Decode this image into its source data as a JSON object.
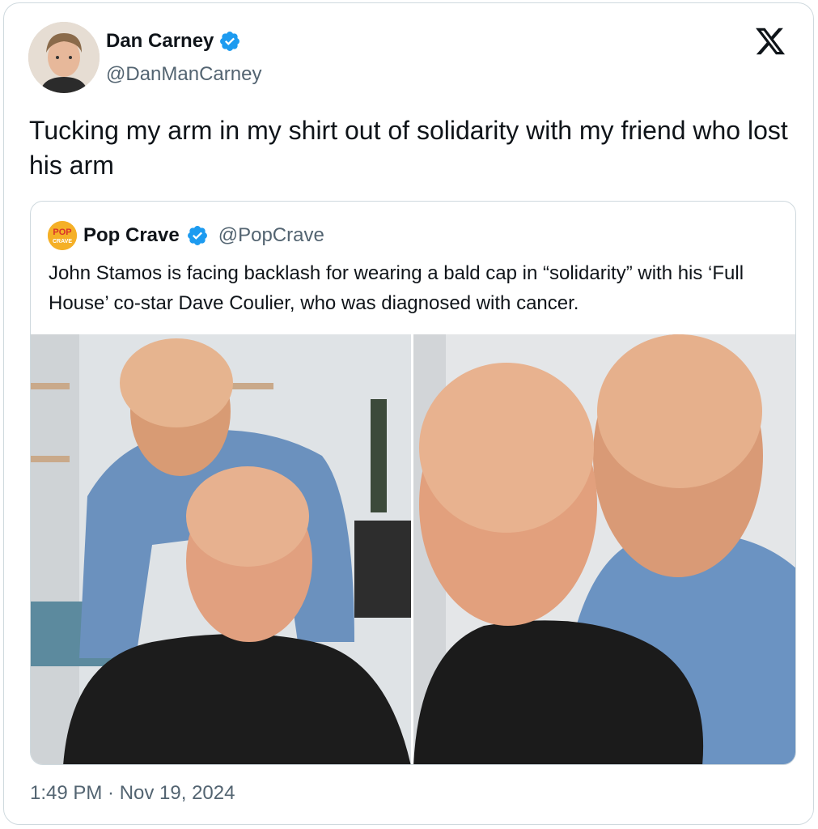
{
  "author": {
    "name": "Dan Carney",
    "handle": "@DanManCarney",
    "verified": true,
    "avatar_icon": "user-avatar-photo"
  },
  "tweet": {
    "text": "Tucking my arm in my shirt out of solidarity with my friend who lost his arm",
    "timestamp": "1:49 PM · Nov 19, 2024"
  },
  "quoted_tweet": {
    "name": "Pop Crave",
    "handle": "@PopCrave",
    "verified": true,
    "avatar_text_top": "POP",
    "avatar_text_bottom": "CRAVE",
    "text": "John Stamos is facing backlash for wearing a bald cap in “solidarity” with his ‘Full House’ co-star Dave Coulier, who was diagnosed with cancer.",
    "media": [
      {
        "alt": "photo-left"
      },
      {
        "alt": "photo-right"
      }
    ]
  },
  "colors": {
    "verified_blue": "#1d9bf0",
    "secondary_text": "#536471",
    "border": "#cfd9de",
    "popcrave_yellow": "#f5b027",
    "popcrave_red": "#d8322a"
  },
  "icons": [
    "x-logo-icon",
    "verified-badge-icon"
  ]
}
